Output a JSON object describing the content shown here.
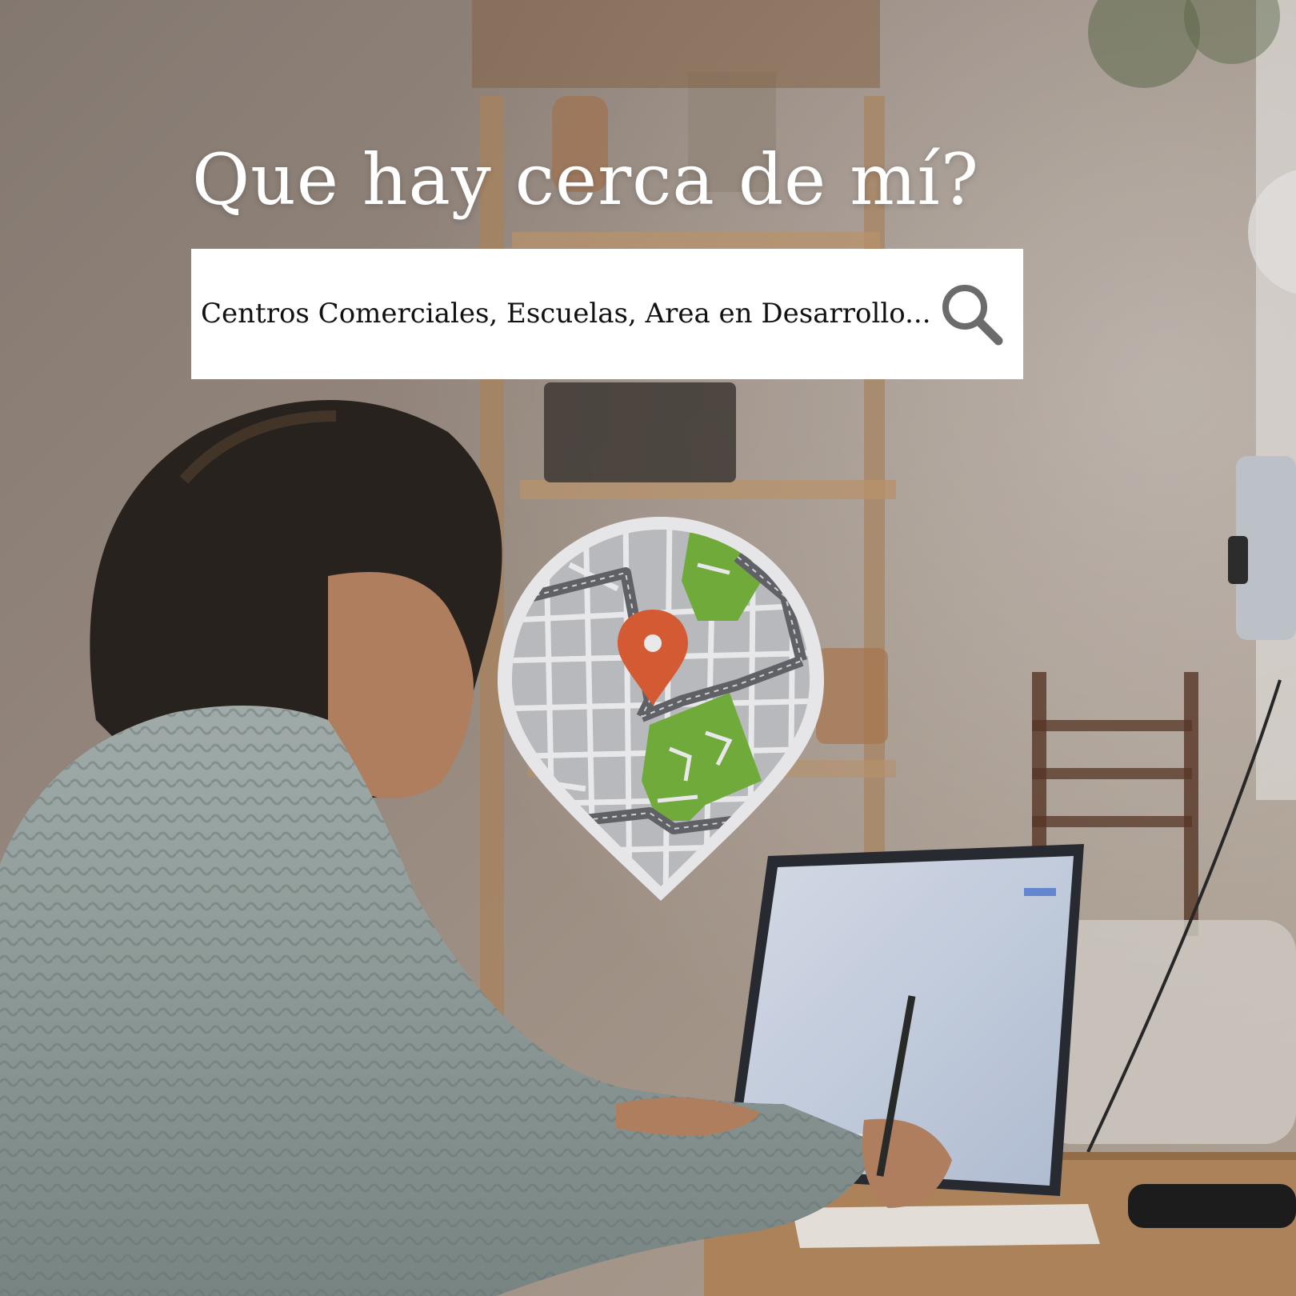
{
  "headline": "Que hay cerca de mí?",
  "search": {
    "text": "Centros Comerciales, Escuelas, Area en Desarrollo...",
    "icon": "search-icon"
  },
  "map_badge": {
    "icon": "map-location-pin-icon"
  },
  "colors": {
    "search_box_bg": "#ffffff",
    "headline_text": "#ffffff",
    "pin_orange": "#d45a34",
    "park_green": "#6faa3a",
    "road_dark": "#5f6166",
    "map_gray": "#b7b9bd"
  }
}
